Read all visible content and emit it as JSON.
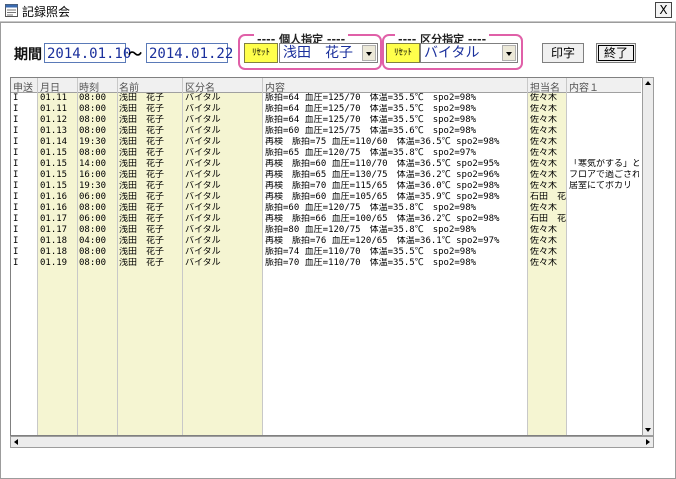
{
  "window": {
    "title": "記録照会",
    "close_label": "X"
  },
  "period": {
    "label": "期間",
    "from": "2014.01.10",
    "separator": "～",
    "to": "2014.01.22"
  },
  "personal_filter": {
    "title": "---- 個人指定 ----",
    "reset_label": "ﾘｾｯﾄ",
    "value": "浅田　花子"
  },
  "category_filter": {
    "title": "---- 区分指定 ----",
    "reset_label": "ﾘｾｯﾄ",
    "value": "バイタル"
  },
  "buttons": {
    "print": "印字",
    "close": "終了"
  },
  "table": {
    "columns": [
      "申送",
      "月日",
      "時刻",
      "名前",
      "区分名",
      "内容",
      "担当名",
      "内容１"
    ],
    "rows": [
      [
        "I",
        "01.11",
        "08:00",
        "浅田　花子",
        "バイタル",
        "脈拍=64 血圧=125/70　体温=35.5℃　spo2=98%",
        "佐々木",
        ""
      ],
      [
        "I",
        "01.11",
        "08:00",
        "浅田　花子",
        "バイタル",
        "脈拍=64 血圧=125/70　体温=35.5℃　spo2=98%",
        "佐々木",
        ""
      ],
      [
        "I",
        "01.12",
        "08:00",
        "浅田　花子",
        "バイタル",
        "脈拍=64 血圧=125/70　体温=35.5℃　spo2=98%",
        "佐々木",
        ""
      ],
      [
        "I",
        "01.13",
        "08:00",
        "浅田　花子",
        "バイタル",
        "脈拍=60 血圧=125/75　体温=35.6℃　spo2=98%",
        "佐々木",
        ""
      ],
      [
        "I",
        "01.14",
        "19:30",
        "浅田　花子",
        "バイタル",
        "再検　脈拍=75 血圧=110/60　体温=36.5℃ spo2=98%",
        "佐々木",
        ""
      ],
      [
        "I",
        "01.15",
        "08:00",
        "浅田　花子",
        "バイタル",
        "脈拍=65 血圧=120/75　体温=35.8℃　spo2=97%",
        "佐々木",
        ""
      ],
      [
        "I",
        "01.15",
        "14:00",
        "浅田　花子",
        "バイタル",
        "再検　脈拍=60 血圧=110/70　体温=36.5℃ spo2=95%",
        "佐々木",
        "「寒気がする」と"
      ],
      [
        "I",
        "01.15",
        "16:00",
        "浅田　花子",
        "バイタル",
        "再検　脈拍=65 血圧=130/75　体温=36.2℃ spo2=96%",
        "佐々木",
        "フロアで過ごされ"
      ],
      [
        "I",
        "01.15",
        "19:30",
        "浅田　花子",
        "バイタル",
        "再検　脈拍=70 血圧=115/65　体温=36.0℃ spo2=98%",
        "佐々木",
        "居室にてボカリ"
      ],
      [
        "I",
        "01.16",
        "06:00",
        "浅田　花子",
        "バイタル",
        "再検　脈拍=60 血圧=105/65　体温=35.9℃ spo2=98%",
        "石田　花",
        ""
      ],
      [
        "I",
        "01.16",
        "08:00",
        "浅田　花子",
        "バイタル",
        "脈拍=60 血圧=120/75　体温=35.8℃　spo2=98%",
        "佐々木",
        ""
      ],
      [
        "I",
        "01.17",
        "06:00",
        "浅田　花子",
        "バイタル",
        "再検　脈拍=66 血圧=100/65　体温=36.2℃ spo2=98%",
        "石田　花",
        ""
      ],
      [
        "I",
        "01.17",
        "08:00",
        "浅田　花子",
        "バイタル",
        "脈拍=80 血圧=120/75　体温=35.8℃　spo2=98%",
        "佐々木",
        ""
      ],
      [
        "I",
        "01.18",
        "04:00",
        "浅田　花子",
        "バイタル",
        "再検　脈拍=76 血圧=120/65　体温=36.1℃ spo2=97%",
        "佐々木",
        ""
      ],
      [
        "I",
        "01.18",
        "08:00",
        "浅田　花子",
        "バイタル",
        "脈拍=74 血圧=110/70　体温=35.5℃　spo2=98%",
        "佐々木",
        ""
      ],
      [
        "I",
        "01.19",
        "08:00",
        "浅田　花子",
        "バイタル",
        "脈拍=70 血圧=110/70　体温=35.5℃　spo2=98%",
        "佐々木",
        ""
      ]
    ]
  }
}
